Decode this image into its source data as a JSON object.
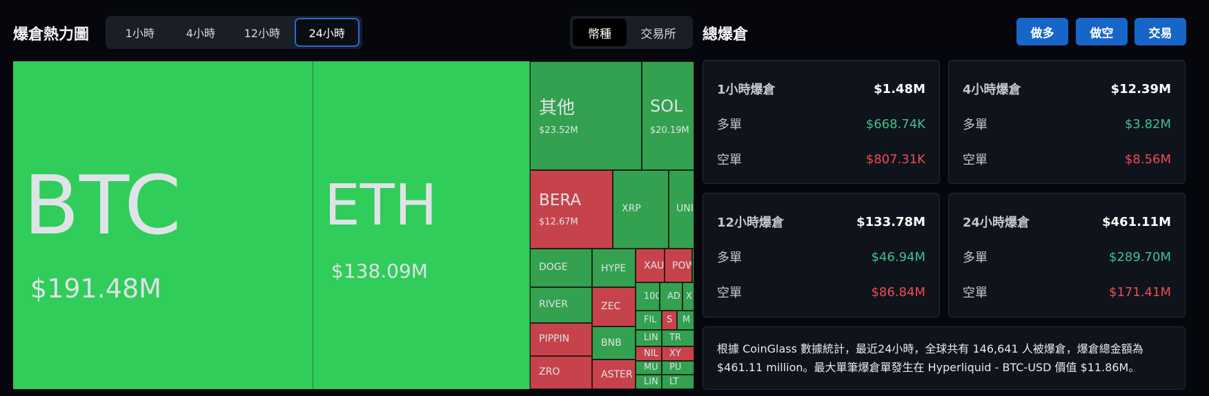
{
  "header": {
    "heatmap_title": "爆倉熱力圖",
    "time_tabs": [
      "1小時",
      "4小時",
      "12小時",
      "24小時"
    ],
    "active_time_tab": "24小時",
    "type_tabs": [
      "幣種",
      "交易所"
    ],
    "active_type_tab": "幣種",
    "total_title": "總爆倉",
    "buttons": {
      "long": "做多",
      "short": "做空",
      "trade": "交易"
    }
  },
  "treemap": {
    "tiles": [
      {
        "name": "BTC",
        "value": "$191.48M"
      },
      {
        "name": "ETH",
        "value": "$138.09M"
      },
      {
        "name": "其他",
        "value": "$23.52M"
      },
      {
        "name": "SOL",
        "value": "$20.19M"
      },
      {
        "name": "BERA",
        "value": "$12.67M"
      },
      {
        "name": "XRP"
      },
      {
        "name": "UNI"
      },
      {
        "name": "DOGE"
      },
      {
        "name": "HYPE"
      },
      {
        "name": "XAU"
      },
      {
        "name": "POW"
      },
      {
        "name": "RIVER"
      },
      {
        "name": "ZEC"
      },
      {
        "name": "100"
      },
      {
        "name": "AD"
      },
      {
        "name": "X"
      },
      {
        "name": "FIL"
      },
      {
        "name": "S"
      },
      {
        "name": "M"
      },
      {
        "name": "PIPPIN"
      },
      {
        "name": "BNB"
      },
      {
        "name": "LIN"
      },
      {
        "name": "TR"
      },
      {
        "name": "NIL"
      },
      {
        "name": "XY"
      },
      {
        "name": "ZRO"
      },
      {
        "name": "ASTER"
      },
      {
        "name": "MU"
      },
      {
        "name": "PU"
      },
      {
        "name": "LIN"
      },
      {
        "name": "LT"
      }
    ]
  },
  "stats": {
    "long_label": "多單",
    "short_label": "空單",
    "cards": [
      {
        "title": "1小時爆倉",
        "total": "$1.48M",
        "long": "$668.74K",
        "short": "$807.31K"
      },
      {
        "title": "4小時爆倉",
        "total": "$12.39M",
        "long": "$3.82M",
        "short": "$8.56M"
      },
      {
        "title": "12小時爆倉",
        "total": "$133.78M",
        "long": "$46.94M",
        "short": "$86.84M"
      },
      {
        "title": "24小時爆倉",
        "total": "$461.11M",
        "long": "$289.70M",
        "short": "$171.41M"
      }
    ]
  },
  "summary": {
    "line1": "根據 CoinGlass 數據統計，最近24小時，全球共有 146,641 人被爆倉，爆倉總金額為",
    "line2": "$461.11 million。最大單筆爆倉單發生在 Hyperliquid - BTC-USD 價值 $11.86M。"
  },
  "colors": {
    "accent": "#1766c7",
    "long": "#3ec28f",
    "short": "#ef4b55",
    "tile_big": "#30cd5a",
    "tile_green": "#33a14f",
    "tile_red": "#c7434c"
  }
}
